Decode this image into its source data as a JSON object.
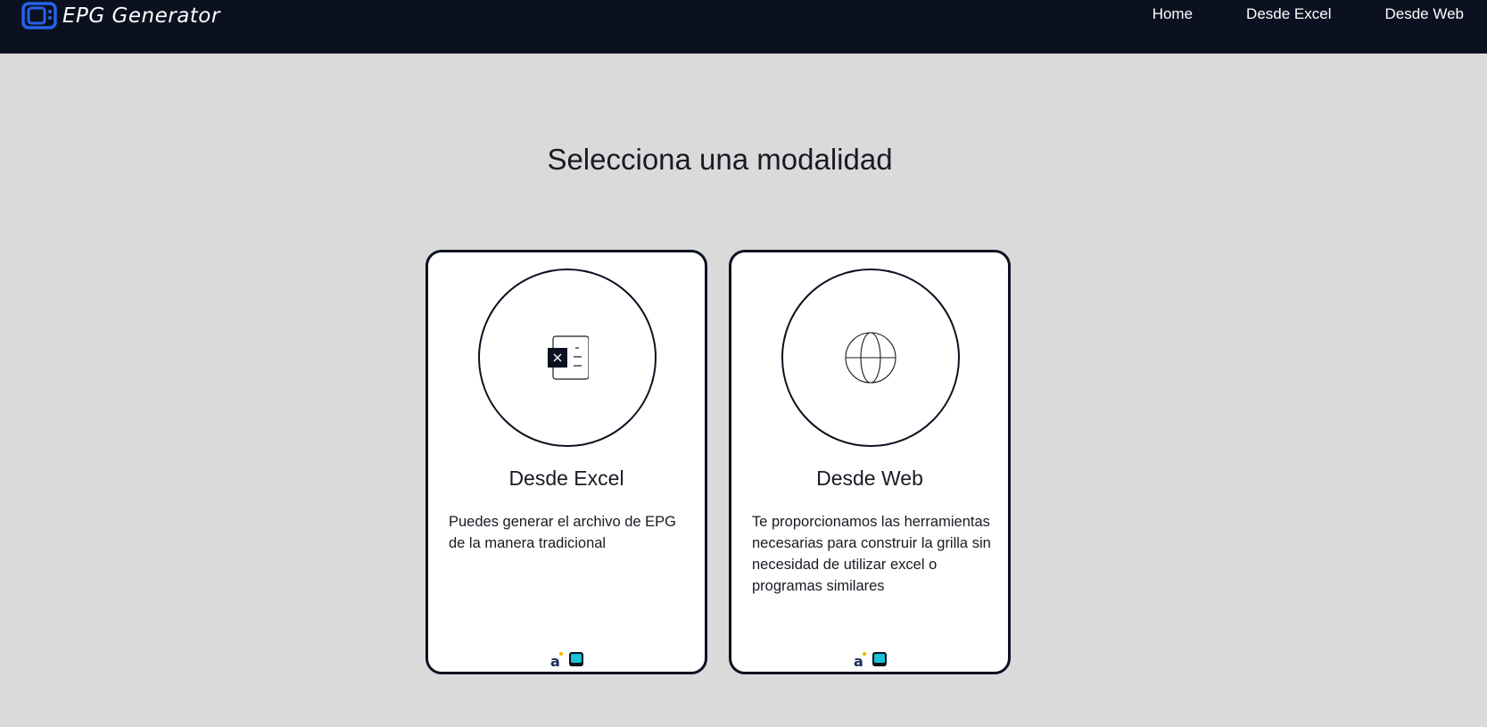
{
  "app": {
    "brand": "EPG Generator"
  },
  "nav": {
    "items": [
      {
        "label": "Home"
      },
      {
        "label": "Desde Excel"
      },
      {
        "label": "Desde Web"
      }
    ]
  },
  "main": {
    "title": "Selecciona una modalidad",
    "cards": [
      {
        "icon": "excel-file-icon",
        "title": "Desde Excel",
        "description": "Puedes generar el archivo de EPG de la manera tradicional"
      },
      {
        "icon": "globe-icon",
        "title": "Desde Web",
        "description": "Te proporcionamos las herramientas necesarias para construir la grilla sin necesidad de utilizar excel o programas similares"
      }
    ]
  },
  "colors": {
    "navbar_bg": "#0b1120",
    "page_bg": "#dadada",
    "brand_icon": "#2563eb",
    "card_border": "#0b1120"
  }
}
